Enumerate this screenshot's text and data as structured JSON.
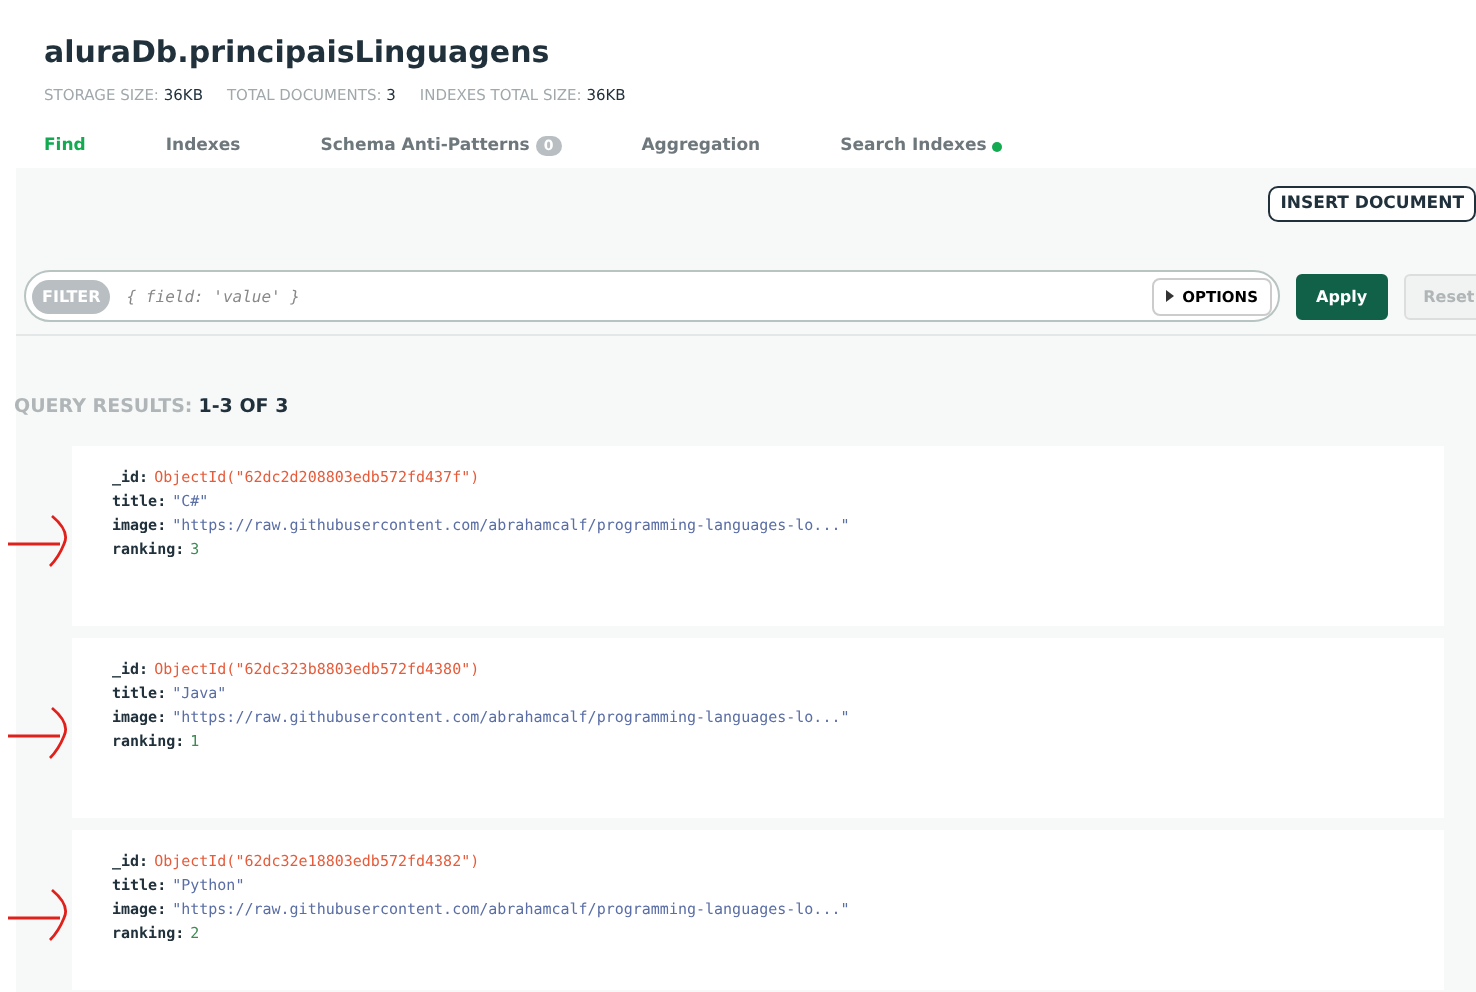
{
  "title": "aluraDb.principaisLinguagens",
  "stats": [
    {
      "label": "STORAGE SIZE:",
      "value": "36KB"
    },
    {
      "label": "TOTAL DOCUMENTS:",
      "value": "3"
    },
    {
      "label": "INDEXES TOTAL SIZE:",
      "value": "36KB"
    }
  ],
  "tabs": [
    {
      "label": "Find",
      "selected": true
    },
    {
      "label": "Indexes",
      "selected": false
    },
    {
      "label": "Schema Anti-Patterns",
      "selected": false,
      "badge": "0"
    },
    {
      "label": "Aggregation",
      "selected": false
    },
    {
      "label": "Search Indexes",
      "selected": false,
      "dot": true
    }
  ],
  "insert_button": "INSERT DOCUMENT",
  "filter": {
    "label": "FILTER",
    "placeholder": "{ field: 'value' }",
    "options": "OPTIONS"
  },
  "buttons": [
    {
      "label": "Apply",
      "disabled": false
    },
    {
      "label": "Reset",
      "disabled": true
    }
  ],
  "results": {
    "label": "QUERY RESULTS:",
    "range": "1-3 OF 3"
  },
  "documents": [
    {
      "fields": [
        {
          "key": "_id:",
          "value": "ObjectId(\"62dc2d208803edb572fd437f\")",
          "kind": "objectid"
        },
        {
          "key": "title:",
          "value": "\"C#\"",
          "kind": "string"
        },
        {
          "key": "image:",
          "value": "\"https://raw.githubusercontent.com/abrahamcalf/programming-languages-lo...\"",
          "kind": "string"
        },
        {
          "key": "ranking:",
          "value": "3",
          "kind": "number"
        }
      ]
    },
    {
      "fields": [
        {
          "key": "_id:",
          "value": "ObjectId(\"62dc323b8803edb572fd4380\")",
          "kind": "objectid"
        },
        {
          "key": "title:",
          "value": "\"Java\"",
          "kind": "string"
        },
        {
          "key": "image:",
          "value": "\"https://raw.githubusercontent.com/abrahamcalf/programming-languages-lo...\"",
          "kind": "string"
        },
        {
          "key": "ranking:",
          "value": "1",
          "kind": "number"
        }
      ]
    },
    {
      "fields": [
        {
          "key": "_id:",
          "value": "ObjectId(\"62dc32e18803edb572fd4382\")",
          "kind": "objectid"
        },
        {
          "key": "title:",
          "value": "\"Python\"",
          "kind": "string"
        },
        {
          "key": "image:",
          "value": "\"https://raw.githubusercontent.com/abrahamcalf/programming-languages-lo...\"",
          "kind": "string"
        },
        {
          "key": "ranking:",
          "value": "2",
          "kind": "number"
        }
      ]
    }
  ]
}
